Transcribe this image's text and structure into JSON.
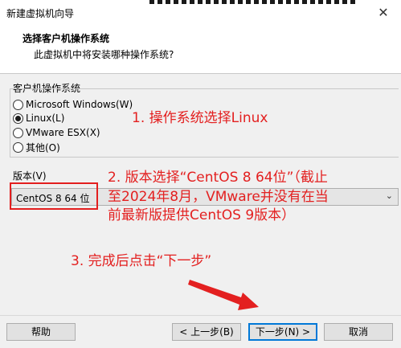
{
  "window": {
    "title": "新建虚拟机向导",
    "close_glyph": "✕"
  },
  "header": {
    "title": "选择客户机操作系统",
    "subtitle": "此虚拟机中将安装哪种操作系统?"
  },
  "os_group": {
    "label": "客户机操作系统",
    "options": [
      {
        "label": "Microsoft Windows(W)",
        "selected": false
      },
      {
        "label": "Linux(L)",
        "selected": true
      },
      {
        "label": "VMware ESX(X)",
        "selected": false
      },
      {
        "label": "其他(O)",
        "selected": false
      }
    ]
  },
  "version": {
    "label": "版本(V)",
    "selected": "CentOS 8 64 位",
    "arrow_glyph": "⌄"
  },
  "annotations": {
    "step1": "1. 操作系统选择Linux",
    "step2_line1": "2. 版本选择“CentOS 8 64位”（截止",
    "step2_line2": "至2024年8月，VMware并没有在当",
    "step2_line3": "前最新版提供CentOS 9版本）",
    "step3": "3. 完成后点击“下一步”",
    "color": "#e32020"
  },
  "buttons": {
    "help": "帮助",
    "back": "< 上一步(B)",
    "next": "下一步(N) >",
    "cancel": "取消"
  },
  "colors": {
    "focus_border": "#0078d7",
    "highlight_box": "#e31e1e"
  }
}
